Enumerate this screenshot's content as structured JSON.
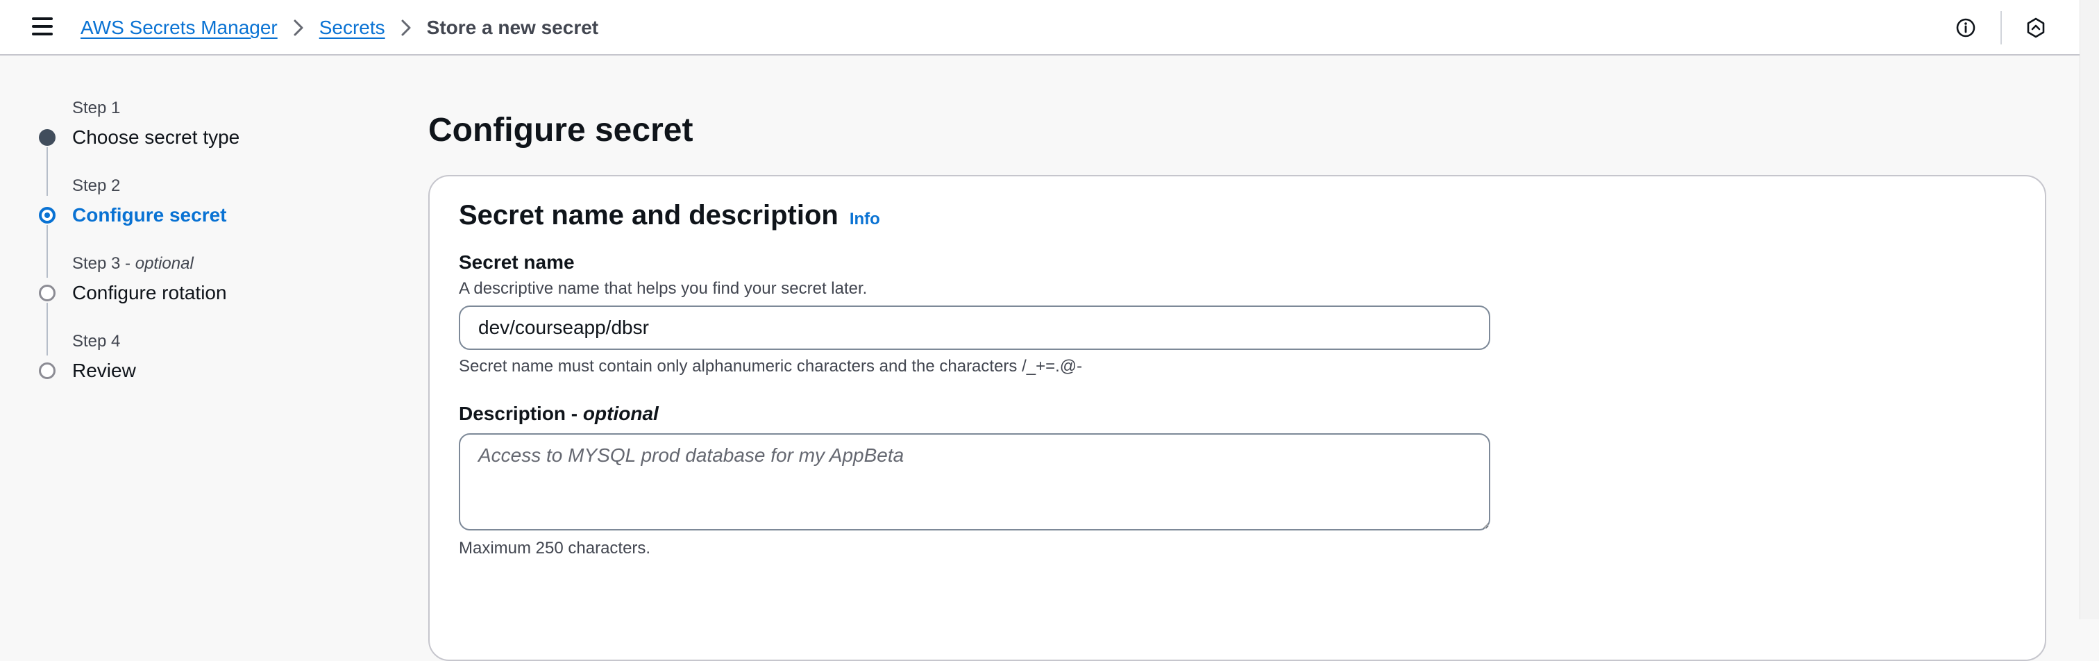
{
  "header": {
    "breadcrumb": {
      "service": "AWS Secrets Manager",
      "section": "Secrets",
      "current": "Store a new secret"
    }
  },
  "steps": [
    {
      "number": "Step 1",
      "optional": "",
      "title": "Choose secret type",
      "state": "done"
    },
    {
      "number": "Step 2",
      "optional": "",
      "title": "Configure secret",
      "state": "active"
    },
    {
      "number": "Step 3",
      "optional": "optional",
      "title": "Configure rotation",
      "state": "pending"
    },
    {
      "number": "Step 4",
      "optional": "",
      "title": "Review",
      "state": "pending"
    }
  ],
  "main": {
    "page_title": "Configure secret",
    "panel": {
      "title": "Secret name and description",
      "info_link": "Info",
      "secret_name": {
        "label": "Secret name",
        "description": "A descriptive name that helps you find your secret later.",
        "value": "dev/courseapp/dbsr",
        "constraint": "Secret name must contain only alphanumeric characters and the characters /_+=.@-"
      },
      "description_field": {
        "label": "Description",
        "optional": "optional",
        "placeholder": "Access to MYSQL prod database for my AppBeta",
        "constraint": "Maximum 250 characters."
      }
    }
  },
  "colors": {
    "accent": "#0972d3",
    "text": "#0f141a",
    "border": "#7d8998",
    "background": "#f8f8f8"
  }
}
